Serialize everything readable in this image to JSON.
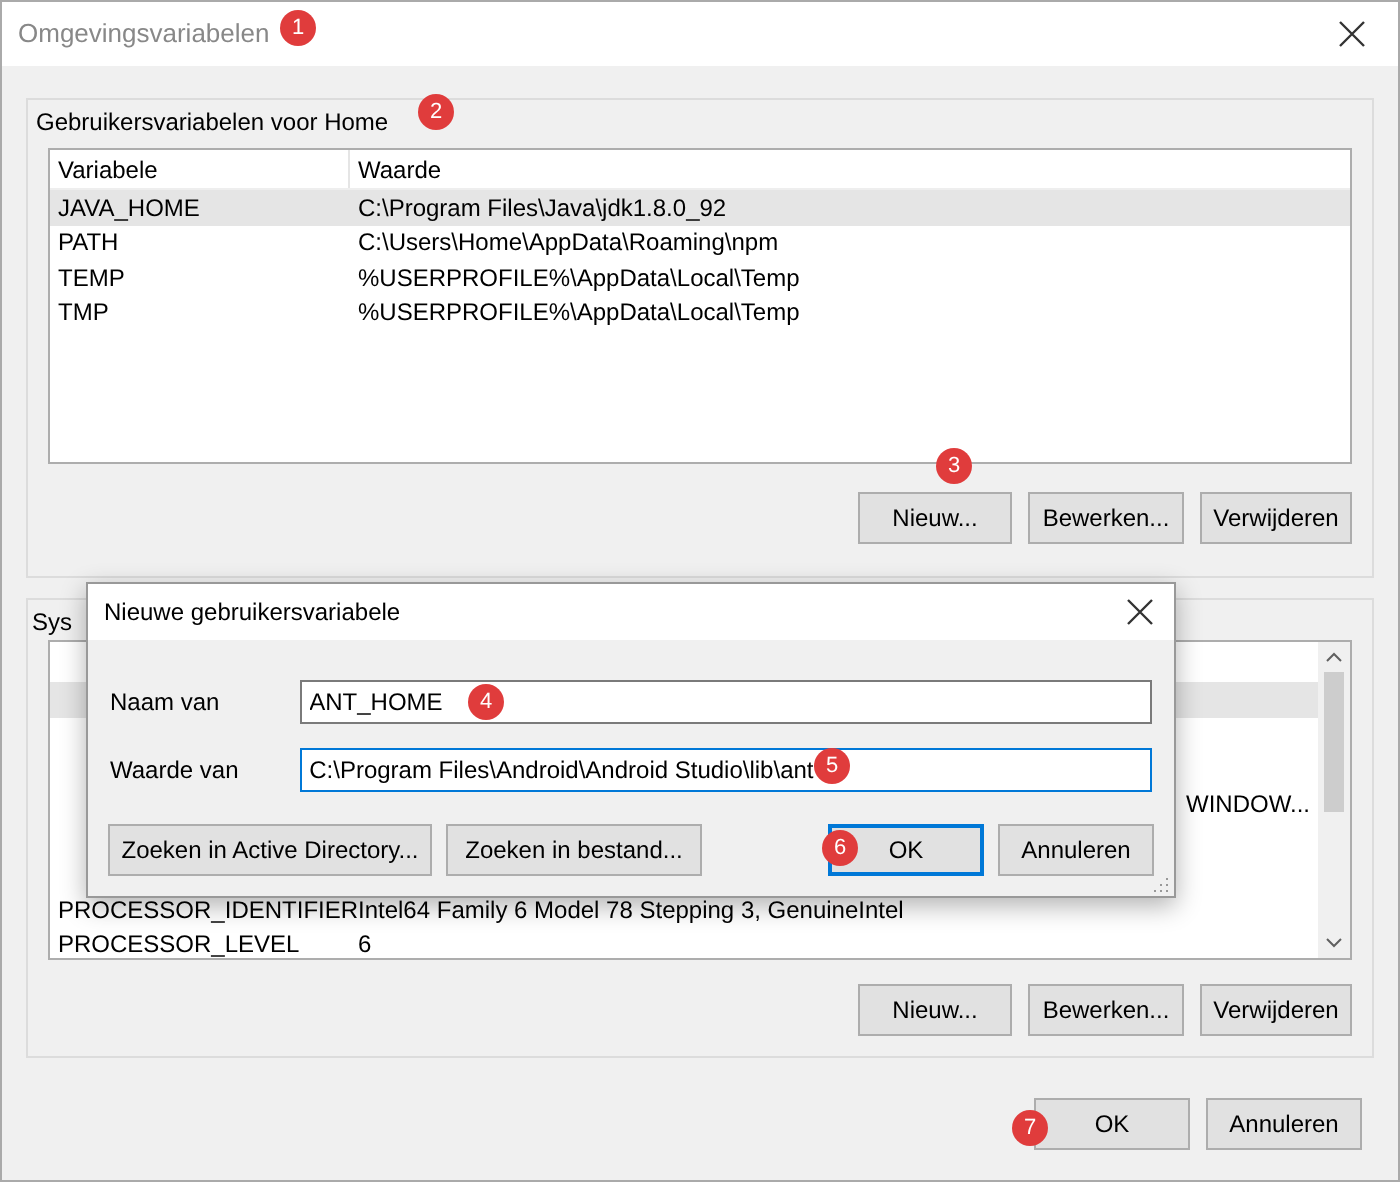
{
  "window": {
    "title": "Omgevingsvariabelen"
  },
  "user_group": {
    "title": "Gebruikersvariabelen voor Home",
    "columns": [
      "Variabele",
      "Waarde"
    ],
    "rows": [
      {
        "name": "JAVA_HOME",
        "value": "C:\\Program Files\\Java\\jdk1.8.0_92",
        "selected": true
      },
      {
        "name": "PATH",
        "value": "C:\\Users\\Home\\AppData\\Roaming\\npm",
        "selected": false
      },
      {
        "name": "TEMP",
        "value": "%USERPROFILE%\\AppData\\Local\\Temp",
        "selected": false
      },
      {
        "name": "TMP",
        "value": "%USERPROFILE%\\AppData\\Local\\Temp",
        "selected": false
      }
    ],
    "buttons": [
      "Nieuw...",
      "Bewerken...",
      "Verwijderen"
    ]
  },
  "system_group": {
    "title": "Sys",
    "rows": [
      {
        "selected": true
      },
      {
        "selected": false
      },
      {
        "selected": false
      },
      {
        "value": "WINDOW...",
        "selected": false
      },
      {
        "selected": false
      },
      {
        "selected": false
      },
      {
        "name": "PROCESSOR_IDENTIFIER",
        "value": "Intel64 Family 6 Model 78 Stepping 3, GenuineIntel",
        "selected": false
      },
      {
        "name": "PROCESSOR_LEVEL",
        "value": "6",
        "selected": false
      }
    ],
    "buttons": [
      "Nieuw...",
      "Bewerken...",
      "Verwijderen"
    ]
  },
  "footer_buttons": [
    "OK",
    "Annuleren"
  ],
  "dialog": {
    "title": "Nieuwe gebruikersvariabele",
    "fields": [
      {
        "label": "Naam van",
        "value": "ANT_HOME",
        "focused": false
      },
      {
        "label": "Waarde van",
        "value": "C:\\Program Files\\Android\\Android Studio\\lib\\ant",
        "focused": true
      }
    ],
    "left_buttons": [
      "Zoeken in Active Directory...",
      "Zoeken in bestand..."
    ],
    "buttons": [
      {
        "label": "OK",
        "default": true
      },
      {
        "label": "Annuleren",
        "default": false
      }
    ]
  },
  "badges": [
    {
      "number": "1"
    },
    {
      "number": "2"
    },
    {
      "number": "3"
    },
    {
      "number": "4"
    },
    {
      "number": "5"
    },
    {
      "number": "6"
    },
    {
      "number": "7"
    }
  ]
}
